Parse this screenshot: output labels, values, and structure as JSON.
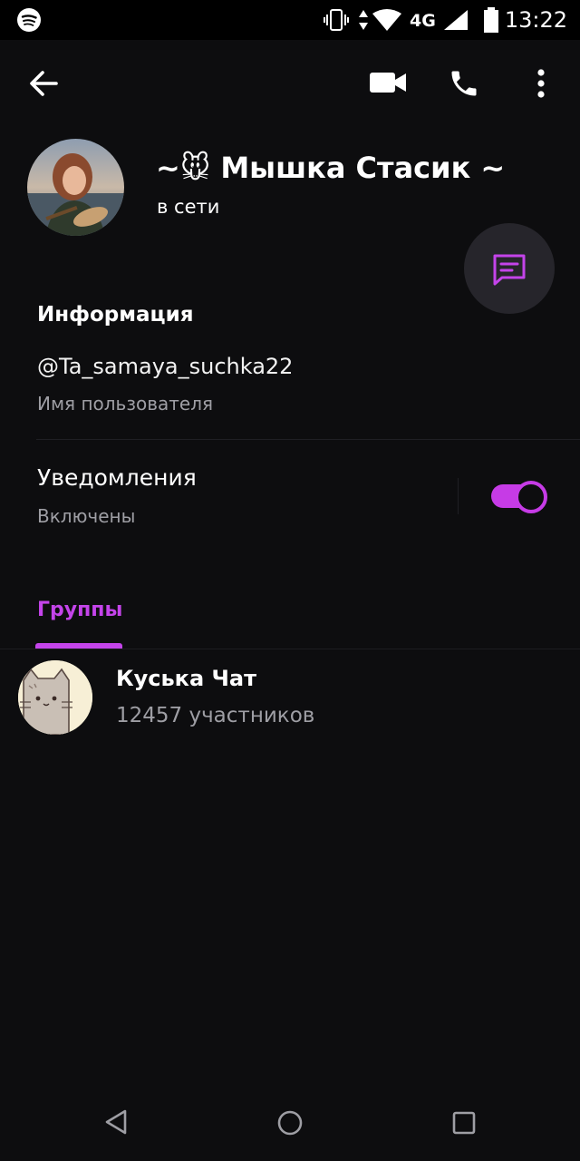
{
  "status_bar": {
    "time": "13:22",
    "network": "4G",
    "icons": [
      "spotify-icon",
      "vibrate-icon",
      "data-arrows-icon",
      "wifi-icon",
      "signal-icon",
      "battery-icon"
    ]
  },
  "app_bar": {
    "icons": [
      "back-arrow-icon",
      "video-call-icon",
      "phone-icon",
      "more-vert-icon"
    ]
  },
  "profile": {
    "name": "~🐭 Мышка Стасик ~",
    "status": "в сети"
  },
  "info": {
    "section_title": "Информация",
    "username": "@Ta_samaya_suchka22",
    "username_caption": "Имя пользователя"
  },
  "notifications": {
    "title": "Уведомления",
    "caption": "Включены",
    "enabled": true
  },
  "tabs": [
    {
      "label": "Группы",
      "active": true
    }
  ],
  "groups": [
    {
      "name": "Куська Чат",
      "members": "12457 участников"
    }
  ],
  "colors": {
    "background": "#0d0d0f",
    "accent": "#c444ea",
    "secondary_text": "#9e9ea4",
    "fab_background": "#26252b"
  },
  "nav_bar": {
    "icons": [
      "nav-back-icon",
      "nav-home-icon",
      "nav-recents-icon"
    ]
  }
}
